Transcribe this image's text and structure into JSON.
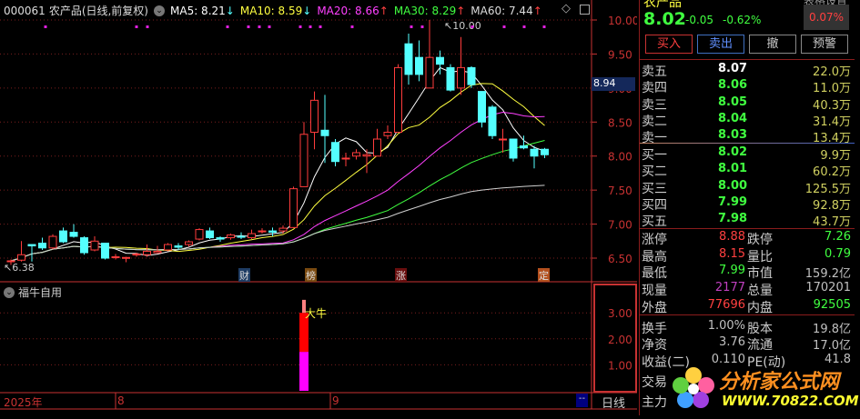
{
  "header": {
    "code": "000061",
    "name": "农产品(日线,前复权)",
    "ma5": "MA5: 8.21",
    "ma10": "MA10: 8.59",
    "ma20": "MA20: 8.66",
    "ma30": "MA30: 8.29",
    "ma60": "MA60: 7.44",
    "ma5_dir": "↓",
    "ma10_dir": "↓",
    "ma20_dir": "↑",
    "ma30_dir": "↑",
    "ma60_dir": "↑"
  },
  "colors": {
    "up": "#ff3c3c",
    "down": "#54ffff",
    "ma5": "#ffffff",
    "ma10": "#ffff40",
    "ma20": "#ff40ff",
    "ma30": "#40ff40",
    "ma60": "#d0d0d0",
    "axis": "#c83232"
  },
  "price_axis": [
    "10.00",
    "9.50",
    "9.00",
    "8.50",
    "8.00",
    "7.50",
    "7.00",
    "6.50"
  ],
  "high_label": "10.00",
  "low_label": "6.38",
  "current_marker": "8.94",
  "events": [
    {
      "label": "财",
      "bg": "#1e3c64"
    },
    {
      "label": "榜",
      "bg": "#7a4a10"
    },
    {
      "label": "涨",
      "bg": "#6a0e0e"
    },
    {
      "label": "定",
      "bg": "#b4501e"
    }
  ],
  "chart_data": {
    "type": "candlestick",
    "ylim": [
      6.3,
      10.1
    ],
    "ohlc": [
      [
        6.45,
        6.48,
        6.4,
        6.46
      ],
      [
        6.47,
        6.75,
        6.45,
        6.55
      ],
      [
        6.7,
        6.7,
        6.45,
        6.68
      ],
      [
        6.72,
        6.8,
        6.62,
        6.65
      ],
      [
        6.65,
        6.85,
        6.63,
        6.82
      ],
      [
        6.9,
        6.95,
        6.72,
        6.74
      ],
      [
        6.88,
        7.0,
        6.8,
        6.82
      ],
      [
        6.8,
        6.82,
        6.55,
        6.58
      ],
      [
        6.62,
        6.82,
        6.6,
        6.75
      ],
      [
        6.72,
        6.72,
        6.48,
        6.5
      ],
      [
        6.52,
        6.56,
        6.48,
        6.52
      ],
      [
        6.5,
        6.52,
        6.44,
        6.51
      ],
      [
        6.55,
        6.58,
        6.52,
        6.56
      ],
      [
        6.55,
        6.7,
        6.52,
        6.6
      ],
      [
        6.58,
        6.68,
        6.57,
        6.6
      ],
      [
        6.62,
        6.72,
        6.6,
        6.7
      ],
      [
        6.68,
        6.72,
        6.62,
        6.66
      ],
      [
        6.7,
        6.76,
        6.67,
        6.74
      ],
      [
        6.78,
        6.94,
        6.76,
        6.92
      ],
      [
        6.9,
        6.95,
        6.78,
        6.8
      ],
      [
        6.8,
        6.82,
        6.74,
        6.78
      ],
      [
        6.8,
        6.86,
        6.77,
        6.84
      ],
      [
        6.82,
        6.88,
        6.78,
        6.81
      ],
      [
        6.8,
        6.92,
        6.78,
        6.86
      ],
      [
        6.9,
        6.94,
        6.86,
        6.9
      ],
      [
        6.9,
        6.95,
        6.82,
        6.88
      ],
      [
        6.9,
        6.98,
        6.86,
        6.94
      ],
      [
        6.95,
        7.55,
        6.94,
        7.52
      ],
      [
        7.55,
        8.5,
        7.55,
        8.32
      ],
      [
        8.35,
        8.95,
        8.1,
        8.82
      ],
      [
        8.38,
        8.9,
        7.9,
        8.3
      ],
      [
        8.2,
        8.25,
        7.85,
        7.92
      ],
      [
        7.97,
        8.05,
        7.85,
        7.97
      ],
      [
        8.0,
        8.1,
        7.95,
        8.05
      ],
      [
        8.0,
        8.1,
        7.75,
        8.02
      ],
      [
        8.0,
        8.4,
        8.0,
        8.25
      ],
      [
        8.3,
        8.45,
        8.25,
        8.35
      ],
      [
        8.35,
        9.35,
        8.35,
        9.3
      ],
      [
        9.65,
        9.8,
        9.05,
        9.2
      ],
      [
        9.45,
        9.7,
        9.1,
        9.2
      ],
      [
        9.0,
        10.0,
        9.0,
        9.45
      ],
      [
        9.45,
        9.55,
        9.2,
        9.35
      ],
      [
        9.3,
        9.35,
        8.95,
        8.97
      ],
      [
        9.0,
        9.75,
        8.9,
        9.3
      ],
      [
        9.3,
        9.32,
        9.0,
        9.05
      ],
      [
        8.95,
        8.95,
        8.42,
        8.5
      ],
      [
        8.72,
        8.75,
        8.25,
        8.3
      ],
      [
        8.25,
        8.4,
        8.05,
        8.25
      ],
      [
        8.25,
        8.25,
        7.92,
        7.97
      ],
      [
        8.15,
        8.3,
        8.1,
        8.12
      ],
      [
        8.1,
        8.15,
        7.82,
        8.0
      ],
      [
        8.1,
        8.12,
        7.97,
        8.02
      ]
    ],
    "indicator": {
      "name": "福牛自用",
      "signal_label": "大牛",
      "signal_index": 28,
      "segments": [
        {
          "from": 0,
          "to": 1.5,
          "color": "#ff00ff"
        },
        {
          "from": 1.5,
          "to": 3.0,
          "color": "#ff0000"
        },
        {
          "from": 3.0,
          "to": 3.5,
          "color": "#ff8080"
        }
      ],
      "axis": [
        "3.00",
        "2.00",
        "1.00"
      ]
    }
  },
  "date_axis": {
    "year": "2025年",
    "m8": "8",
    "m9": "9",
    "period": "日线",
    "nav": "--"
  },
  "quote": {
    "title": "农产品",
    "top_right": "表格设置",
    "price": "8.02",
    "change": "-0.05",
    "pct": "-0.62%",
    "small_pct": "0.07%"
  },
  "buttons": {
    "buy": "买入",
    "sell": "卖出",
    "cancel": "撤",
    "alert": "预警"
  },
  "asks": [
    {
      "label": "卖五",
      "price": "8.07",
      "vol": "22.0万"
    },
    {
      "label": "卖四",
      "price": "8.06",
      "vol": "11.0万"
    },
    {
      "label": "卖三",
      "price": "8.05",
      "vol": "40.3万"
    },
    {
      "label": "卖二",
      "price": "8.04",
      "vol": "31.4万"
    },
    {
      "label": "卖一",
      "price": "8.03",
      "vol": "13.4万"
    }
  ],
  "bids": [
    {
      "label": "买一",
      "price": "8.02",
      "vol": "9.9万"
    },
    {
      "label": "买二",
      "price": "8.01",
      "vol": "60.2万"
    },
    {
      "label": "买三",
      "price": "8.00",
      "vol": "125.5万"
    },
    {
      "label": "买四",
      "price": "7.99",
      "vol": "92.8万"
    },
    {
      "label": "买五",
      "price": "7.98",
      "vol": "43.7万"
    }
  ],
  "stats": [
    {
      "l1": "涨停",
      "v1": "8.88",
      "c1": "#ff4040",
      "l2": "跌停",
      "v2": "7.26",
      "c2": "#40ff40"
    },
    {
      "l1": "最高",
      "v1": "8.15",
      "c1": "#ff4040",
      "l2": "量比",
      "v2": "0.79",
      "c2": "#40ff40"
    },
    {
      "l1": "最低",
      "v1": "7.99",
      "c1": "#40ff40",
      "l2": "市值",
      "v2": "159.2亿",
      "c2": "#c0c0c0"
    },
    {
      "l1": "现量",
      "v1": "2177",
      "c1": "#c040c0",
      "l2": "总量",
      "v2": "170201",
      "c2": "#c0c0c0"
    },
    {
      "l1": "外盘",
      "v1": "77696",
      "c1": "#ff4040",
      "l2": "内盘",
      "v2": "92505",
      "c2": "#40ff40"
    },
    {
      "l1": "换手",
      "v1": "1.00%",
      "c1": "#c0c0c0",
      "l2": "股本",
      "v2": "19.8亿",
      "c2": "#c0c0c0"
    },
    {
      "l1": "净资",
      "v1": "3.76",
      "c1": "#c0c0c0",
      "l2": "流通",
      "v2": "17.0亿",
      "c2": "#c0c0c0"
    },
    {
      "l1": "收益(二)",
      "v1": "0.110",
      "c1": "#c0c0c0",
      "l2": "PE(动)",
      "v2": "41.8",
      "c2": "#c0c0c0"
    }
  ],
  "extra_rows": [
    "交易",
    "主力"
  ],
  "watermark": {
    "name": "分析家公式网",
    "url": "WWW.70822.COM"
  }
}
